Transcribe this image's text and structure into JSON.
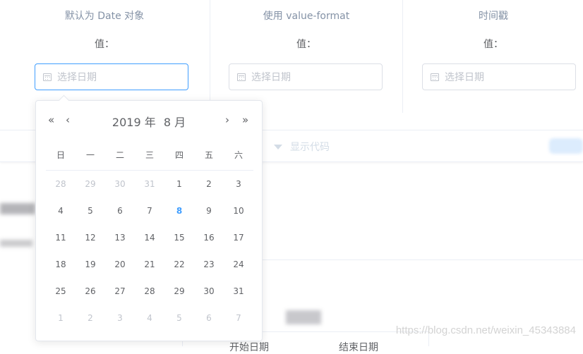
{
  "columns": [
    {
      "title": "默认为 Date 对象",
      "value_label": "值：",
      "placeholder": "选择日期"
    },
    {
      "title": "使用 value-format",
      "value_label": "值：",
      "placeholder": "选择日期"
    },
    {
      "title": "时间戳",
      "value_label": "值：",
      "placeholder": "选择日期"
    }
  ],
  "toolbar": {
    "show_code": "显示代码"
  },
  "picker": {
    "prev_year": "«",
    "prev_month": "‹",
    "next_month": "›",
    "next_year": "»",
    "year": "2019 年",
    "month": "8 月",
    "weekdays": [
      "日",
      "一",
      "二",
      "三",
      "四",
      "五",
      "六"
    ],
    "days": [
      {
        "d": "28",
        "t": "prev"
      },
      {
        "d": "29",
        "t": "prev"
      },
      {
        "d": "30",
        "t": "prev"
      },
      {
        "d": "31",
        "t": "prev"
      },
      {
        "d": "1",
        "t": "cur"
      },
      {
        "d": "2",
        "t": "cur"
      },
      {
        "d": "3",
        "t": "cur"
      },
      {
        "d": "4",
        "t": "cur"
      },
      {
        "d": "5",
        "t": "cur"
      },
      {
        "d": "6",
        "t": "cur"
      },
      {
        "d": "7",
        "t": "cur"
      },
      {
        "d": "8",
        "t": "today"
      },
      {
        "d": "9",
        "t": "cur"
      },
      {
        "d": "10",
        "t": "cur"
      },
      {
        "d": "11",
        "t": "cur"
      },
      {
        "d": "12",
        "t": "cur"
      },
      {
        "d": "13",
        "t": "cur"
      },
      {
        "d": "14",
        "t": "cur"
      },
      {
        "d": "15",
        "t": "cur"
      },
      {
        "d": "16",
        "t": "cur"
      },
      {
        "d": "17",
        "t": "cur"
      },
      {
        "d": "18",
        "t": "cur"
      },
      {
        "d": "19",
        "t": "cur"
      },
      {
        "d": "20",
        "t": "cur"
      },
      {
        "d": "21",
        "t": "cur"
      },
      {
        "d": "22",
        "t": "cur"
      },
      {
        "d": "23",
        "t": "cur"
      },
      {
        "d": "24",
        "t": "cur"
      },
      {
        "d": "25",
        "t": "cur"
      },
      {
        "d": "26",
        "t": "cur"
      },
      {
        "d": "27",
        "t": "cur"
      },
      {
        "d": "28",
        "t": "cur"
      },
      {
        "d": "29",
        "t": "cur"
      },
      {
        "d": "30",
        "t": "cur"
      },
      {
        "d": "31",
        "t": "cur"
      },
      {
        "d": "1",
        "t": "next"
      },
      {
        "d": "2",
        "t": "next"
      },
      {
        "d": "3",
        "t": "next"
      },
      {
        "d": "4",
        "t": "next"
      },
      {
        "d": "5",
        "t": "next"
      },
      {
        "d": "6",
        "t": "next"
      },
      {
        "d": "7",
        "t": "next"
      }
    ]
  },
  "bottom": {
    "start_label": "开始日期",
    "end_label": "结束日期"
  },
  "watermark": "https://blog.csdn.net/weixin_45343884",
  "colors": {
    "accent": "#409eff",
    "text": "#606266",
    "muted": "#c0c4cc",
    "border": "#dcdfe6"
  }
}
